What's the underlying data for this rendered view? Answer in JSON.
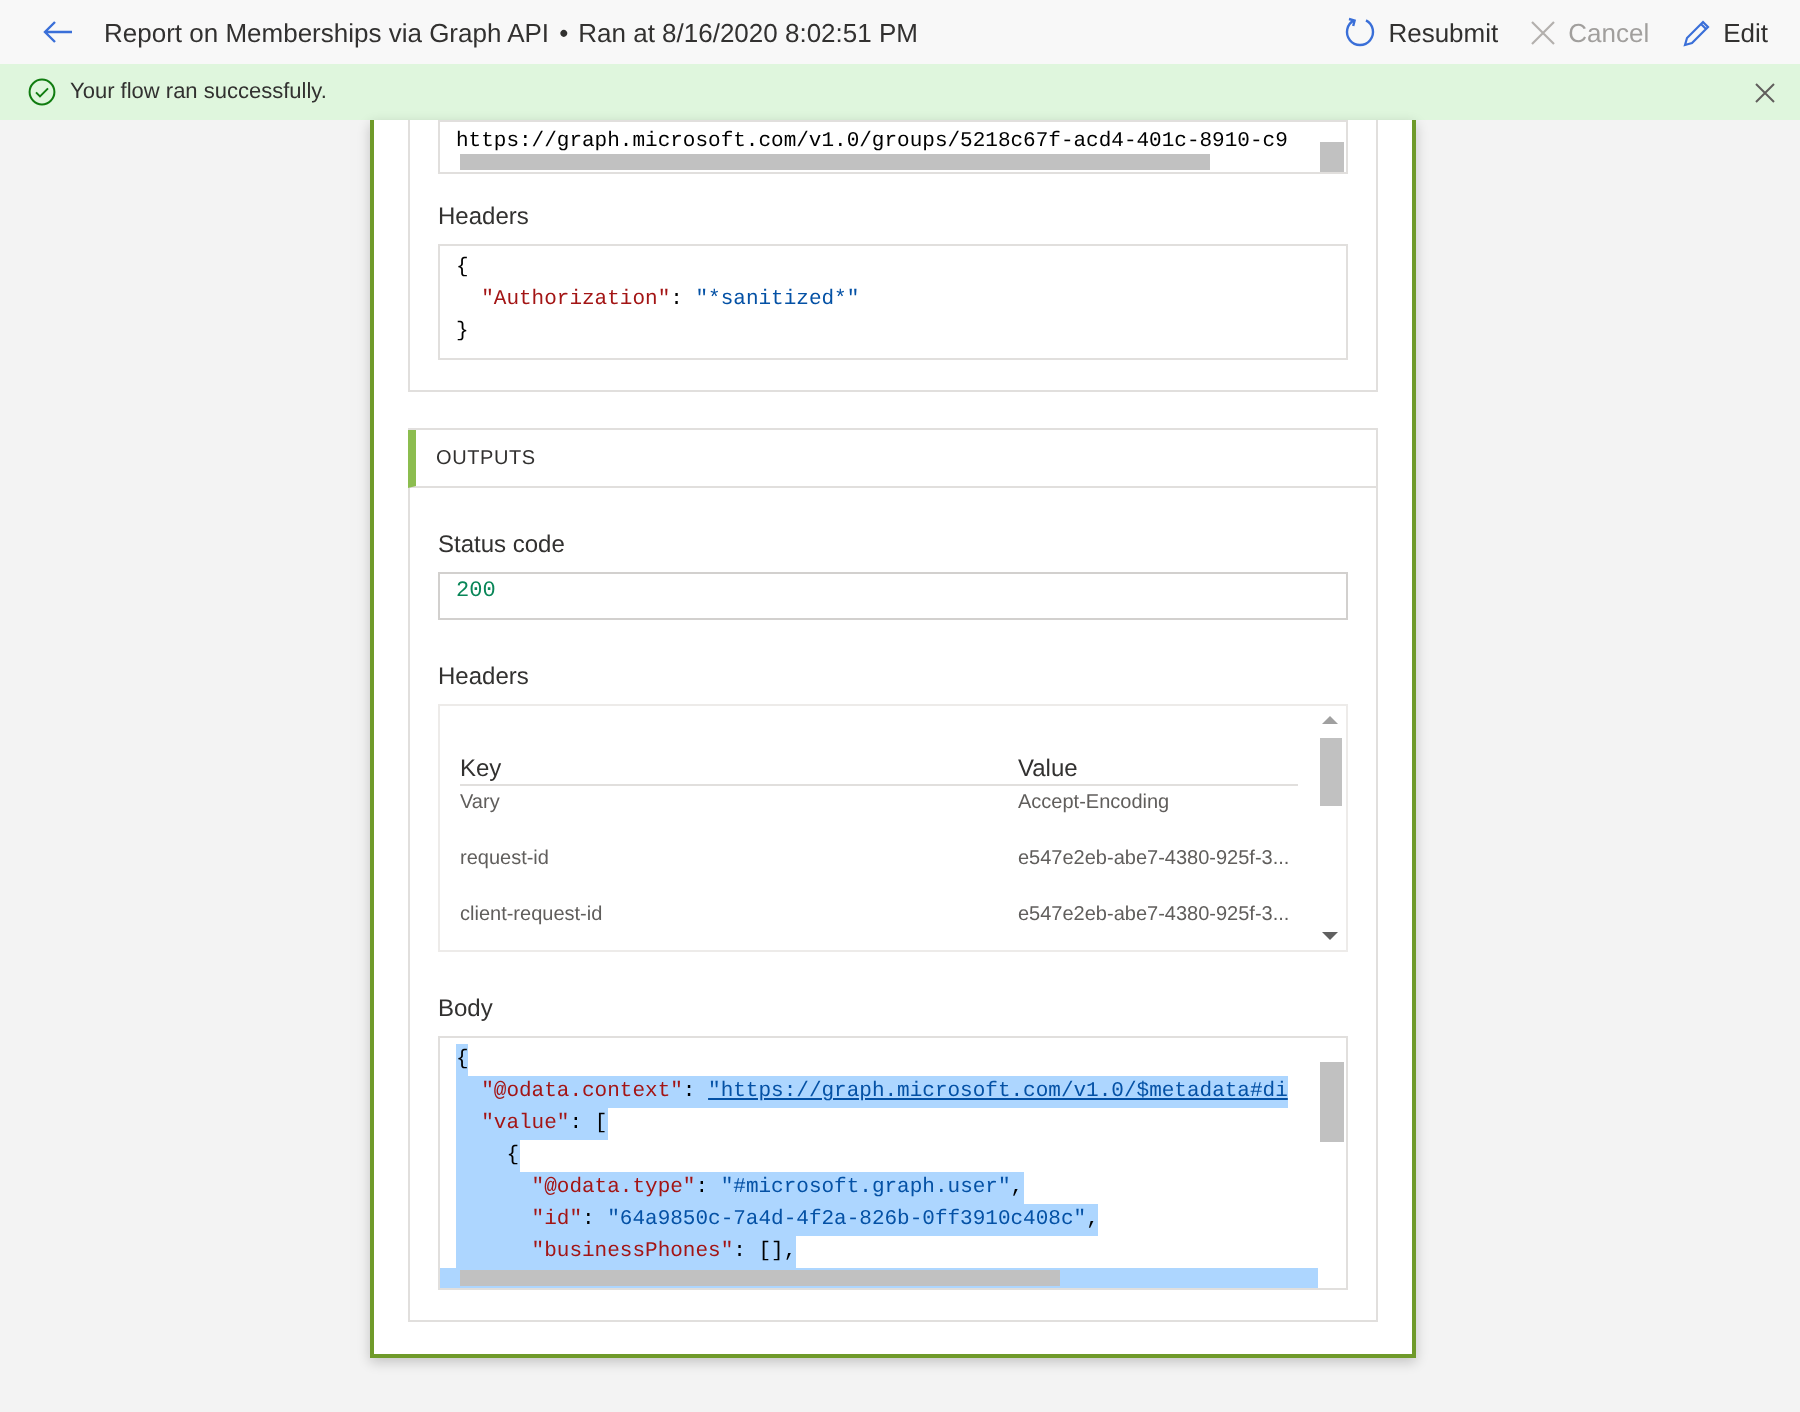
{
  "header": {
    "title": "Report on Memberships via Graph API",
    "separator": "•",
    "run_time": "Ran at 8/16/2020 8:02:51 PM",
    "actions": [
      {
        "kind": "resubmit",
        "label": "Resubmit",
        "disabled": false
      },
      {
        "kind": "cancel",
        "label": "Cancel",
        "disabled": true
      },
      {
        "kind": "edit",
        "label": "Edit",
        "disabled": false
      }
    ]
  },
  "notification": {
    "kind": "success",
    "message": "Your flow ran successfully."
  },
  "inputs": {
    "uri": {
      "selected": false,
      "lines": [
        [
          {
            "kind": "text",
            "text": "https://graph.microsoft.com/v1.0/groups/5218c67f-acd4-401c-8910-c9"
          }
        ]
      ]
    },
    "headers_label": "Headers",
    "headers": {
      "selected": false,
      "lines": [
        [
          {
            "kind": "punct",
            "text": "{"
          }
        ],
        [
          {
            "kind": "key",
            "text": "  \"Authorization\""
          },
          {
            "kind": "punct",
            "text": ": "
          },
          {
            "kind": "string",
            "text": "\"*sanitized*\""
          }
        ],
        [
          {
            "kind": "punct",
            "text": "}"
          }
        ]
      ]
    }
  },
  "outputs": {
    "title": "OUTPUTS",
    "status_label": "Status code",
    "status_code": "200",
    "headers_label": "Headers",
    "headers_table": {
      "columns": [
        "Key",
        "Value"
      ],
      "rows": [
        [
          "Vary",
          "Accept-Encoding"
        ],
        [
          "request-id",
          "e547e2eb-abe7-4380-925f-3..."
        ],
        [
          "client-request-id",
          "e547e2eb-abe7-4380-925f-3..."
        ]
      ]
    },
    "body_label": "Body",
    "body": {
      "selected": true,
      "lines": [
        [
          {
            "kind": "punct",
            "text": "{"
          }
        ],
        [
          {
            "kind": "key",
            "text": "  \"@odata.context\""
          },
          {
            "kind": "punct",
            "text": ": "
          },
          {
            "kind": "link",
            "text": "\"https://graph.microsoft.com/v1.0/$metadata#di"
          }
        ],
        [
          {
            "kind": "key",
            "text": "  \"value\""
          },
          {
            "kind": "punct",
            "text": ": ["
          }
        ],
        [
          {
            "kind": "punct",
            "text": "    {"
          }
        ],
        [
          {
            "kind": "key",
            "text": "      \"@odata.type\""
          },
          {
            "kind": "punct",
            "text": ": "
          },
          {
            "kind": "string",
            "text": "\"#microsoft.graph.user\""
          },
          {
            "kind": "punct",
            "text": ","
          }
        ],
        [
          {
            "kind": "key",
            "text": "      \"id\""
          },
          {
            "kind": "punct",
            "text": ": "
          },
          {
            "kind": "string",
            "text": "\"64a9850c-7a4d-4f2a-826b-0ff3910c408c\""
          },
          {
            "kind": "punct",
            "text": ","
          }
        ],
        [
          {
            "kind": "key",
            "text": "      \"businessPhones\""
          },
          {
            "kind": "punct",
            "text": ": [],"
          }
        ]
      ]
    }
  }
}
